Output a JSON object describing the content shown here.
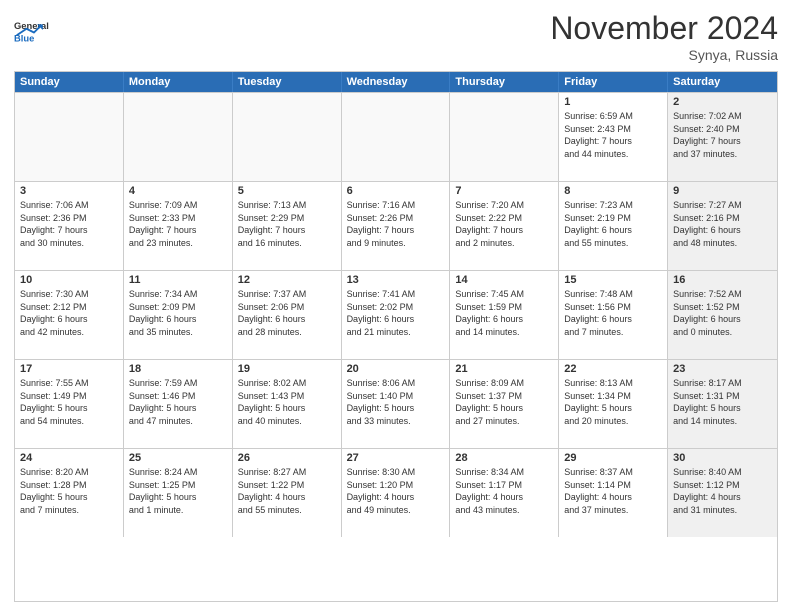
{
  "header": {
    "logo_general": "General",
    "logo_blue": "Blue",
    "month_title": "November 2024",
    "location": "Synya, Russia"
  },
  "days_of_week": [
    "Sunday",
    "Monday",
    "Tuesday",
    "Wednesday",
    "Thursday",
    "Friday",
    "Saturday"
  ],
  "rows": [
    {
      "cells": [
        {
          "day": "",
          "info": "",
          "empty": true
        },
        {
          "day": "",
          "info": "",
          "empty": true
        },
        {
          "day": "",
          "info": "",
          "empty": true
        },
        {
          "day": "",
          "info": "",
          "empty": true
        },
        {
          "day": "",
          "info": "",
          "empty": true
        },
        {
          "day": "1",
          "info": "Sunrise: 6:59 AM\nSunset: 2:43 PM\nDaylight: 7 hours\nand 44 minutes.",
          "empty": false,
          "shaded": false
        },
        {
          "day": "2",
          "info": "Sunrise: 7:02 AM\nSunset: 2:40 PM\nDaylight: 7 hours\nand 37 minutes.",
          "empty": false,
          "shaded": true
        }
      ]
    },
    {
      "cells": [
        {
          "day": "3",
          "info": "Sunrise: 7:06 AM\nSunset: 2:36 PM\nDaylight: 7 hours\nand 30 minutes.",
          "empty": false,
          "shaded": false
        },
        {
          "day": "4",
          "info": "Sunrise: 7:09 AM\nSunset: 2:33 PM\nDaylight: 7 hours\nand 23 minutes.",
          "empty": false,
          "shaded": false
        },
        {
          "day": "5",
          "info": "Sunrise: 7:13 AM\nSunset: 2:29 PM\nDaylight: 7 hours\nand 16 minutes.",
          "empty": false,
          "shaded": false
        },
        {
          "day": "6",
          "info": "Sunrise: 7:16 AM\nSunset: 2:26 PM\nDaylight: 7 hours\nand 9 minutes.",
          "empty": false,
          "shaded": false
        },
        {
          "day": "7",
          "info": "Sunrise: 7:20 AM\nSunset: 2:22 PM\nDaylight: 7 hours\nand 2 minutes.",
          "empty": false,
          "shaded": false
        },
        {
          "day": "8",
          "info": "Sunrise: 7:23 AM\nSunset: 2:19 PM\nDaylight: 6 hours\nand 55 minutes.",
          "empty": false,
          "shaded": false
        },
        {
          "day": "9",
          "info": "Sunrise: 7:27 AM\nSunset: 2:16 PM\nDaylight: 6 hours\nand 48 minutes.",
          "empty": false,
          "shaded": true
        }
      ]
    },
    {
      "cells": [
        {
          "day": "10",
          "info": "Sunrise: 7:30 AM\nSunset: 2:12 PM\nDaylight: 6 hours\nand 42 minutes.",
          "empty": false,
          "shaded": false
        },
        {
          "day": "11",
          "info": "Sunrise: 7:34 AM\nSunset: 2:09 PM\nDaylight: 6 hours\nand 35 minutes.",
          "empty": false,
          "shaded": false
        },
        {
          "day": "12",
          "info": "Sunrise: 7:37 AM\nSunset: 2:06 PM\nDaylight: 6 hours\nand 28 minutes.",
          "empty": false,
          "shaded": false
        },
        {
          "day": "13",
          "info": "Sunrise: 7:41 AM\nSunset: 2:02 PM\nDaylight: 6 hours\nand 21 minutes.",
          "empty": false,
          "shaded": false
        },
        {
          "day": "14",
          "info": "Sunrise: 7:45 AM\nSunset: 1:59 PM\nDaylight: 6 hours\nand 14 minutes.",
          "empty": false,
          "shaded": false
        },
        {
          "day": "15",
          "info": "Sunrise: 7:48 AM\nSunset: 1:56 PM\nDaylight: 6 hours\nand 7 minutes.",
          "empty": false,
          "shaded": false
        },
        {
          "day": "16",
          "info": "Sunrise: 7:52 AM\nSunset: 1:52 PM\nDaylight: 6 hours\nand 0 minutes.",
          "empty": false,
          "shaded": true
        }
      ]
    },
    {
      "cells": [
        {
          "day": "17",
          "info": "Sunrise: 7:55 AM\nSunset: 1:49 PM\nDaylight: 5 hours\nand 54 minutes.",
          "empty": false,
          "shaded": false
        },
        {
          "day": "18",
          "info": "Sunrise: 7:59 AM\nSunset: 1:46 PM\nDaylight: 5 hours\nand 47 minutes.",
          "empty": false,
          "shaded": false
        },
        {
          "day": "19",
          "info": "Sunrise: 8:02 AM\nSunset: 1:43 PM\nDaylight: 5 hours\nand 40 minutes.",
          "empty": false,
          "shaded": false
        },
        {
          "day": "20",
          "info": "Sunrise: 8:06 AM\nSunset: 1:40 PM\nDaylight: 5 hours\nand 33 minutes.",
          "empty": false,
          "shaded": false
        },
        {
          "day": "21",
          "info": "Sunrise: 8:09 AM\nSunset: 1:37 PM\nDaylight: 5 hours\nand 27 minutes.",
          "empty": false,
          "shaded": false
        },
        {
          "day": "22",
          "info": "Sunrise: 8:13 AM\nSunset: 1:34 PM\nDaylight: 5 hours\nand 20 minutes.",
          "empty": false,
          "shaded": false
        },
        {
          "day": "23",
          "info": "Sunrise: 8:17 AM\nSunset: 1:31 PM\nDaylight: 5 hours\nand 14 minutes.",
          "empty": false,
          "shaded": true
        }
      ]
    },
    {
      "cells": [
        {
          "day": "24",
          "info": "Sunrise: 8:20 AM\nSunset: 1:28 PM\nDaylight: 5 hours\nand 7 minutes.",
          "empty": false,
          "shaded": false
        },
        {
          "day": "25",
          "info": "Sunrise: 8:24 AM\nSunset: 1:25 PM\nDaylight: 5 hours\nand 1 minute.",
          "empty": false,
          "shaded": false
        },
        {
          "day": "26",
          "info": "Sunrise: 8:27 AM\nSunset: 1:22 PM\nDaylight: 4 hours\nand 55 minutes.",
          "empty": false,
          "shaded": false
        },
        {
          "day": "27",
          "info": "Sunrise: 8:30 AM\nSunset: 1:20 PM\nDaylight: 4 hours\nand 49 minutes.",
          "empty": false,
          "shaded": false
        },
        {
          "day": "28",
          "info": "Sunrise: 8:34 AM\nSunset: 1:17 PM\nDaylight: 4 hours\nand 43 minutes.",
          "empty": false,
          "shaded": false
        },
        {
          "day": "29",
          "info": "Sunrise: 8:37 AM\nSunset: 1:14 PM\nDaylight: 4 hours\nand 37 minutes.",
          "empty": false,
          "shaded": false
        },
        {
          "day": "30",
          "info": "Sunrise: 8:40 AM\nSunset: 1:12 PM\nDaylight: 4 hours\nand 31 minutes.",
          "empty": false,
          "shaded": true
        }
      ]
    }
  ]
}
